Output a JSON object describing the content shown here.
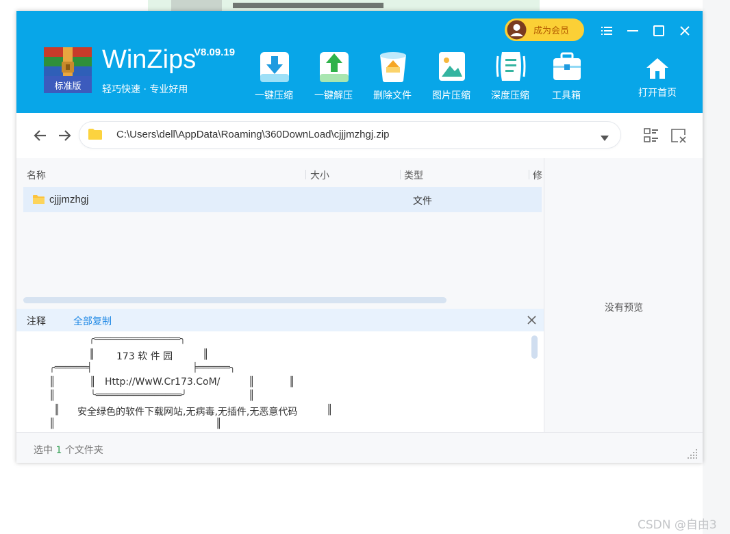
{
  "app": {
    "name": "WinZips",
    "version": "V8.09.19",
    "slogan": "轻巧快速 · 专业好用",
    "logo_badge": "标准版",
    "vip_label": "成为会员"
  },
  "toolbar": [
    {
      "label": "一键压缩",
      "icon": "compress-download-icon"
    },
    {
      "label": "一键解压",
      "icon": "extract-upload-icon"
    },
    {
      "label": "删除文件",
      "icon": "trash-icon"
    },
    {
      "label": "图片压缩",
      "icon": "image-icon"
    },
    {
      "label": "深度压缩",
      "icon": "deep-compress-icon"
    },
    {
      "label": "工具箱",
      "icon": "toolbox-icon"
    }
  ],
  "home_label": "打开首页",
  "address": {
    "path": "C:\\Users\\dell\\AppData\\Roaming\\360DownLoad\\cjjjmzhgj.zip"
  },
  "columns": [
    "名称",
    "大小",
    "类型",
    "修"
  ],
  "files": [
    {
      "name": "cjjjmzhgj",
      "size": "",
      "type": "文件"
    }
  ],
  "preview": {
    "empty_text": "没有预览"
  },
  "notes": {
    "label": "注释",
    "copy_all": "全部复制",
    "site_name": "173 软 件 园",
    "site_url": "Http://WwW.Cr173.CoM/",
    "tagline": "安全绿色的软件下载网站,无病毒,无插件,无恶意代码",
    "art": {
      "row1": "╭════════════════╮",
      "row2a": "║",
      "row2b": "║",
      "row3a": "╭══════╡",
      "row3b": "╞══════╮",
      "row4a": "║",
      "row4b": "║",
      "row4c": "║",
      "row4d": "║",
      "row5a": "║",
      "row5b": "╰════════════════╯",
      "row5c": "║",
      "row6a": "║",
      "row6b": "║",
      "row7a": "║",
      "row7b": "║"
    }
  },
  "status": {
    "prefix": "选中",
    "count": "1",
    "suffix": "个文件夹"
  },
  "watermark": "CSDN @自由3",
  "colors": {
    "titlebar": "#08a6e8",
    "vip": "#fbd036",
    "selected_row": "#e3eefb",
    "link": "#1e88e5",
    "count": "#2e9d4f"
  }
}
